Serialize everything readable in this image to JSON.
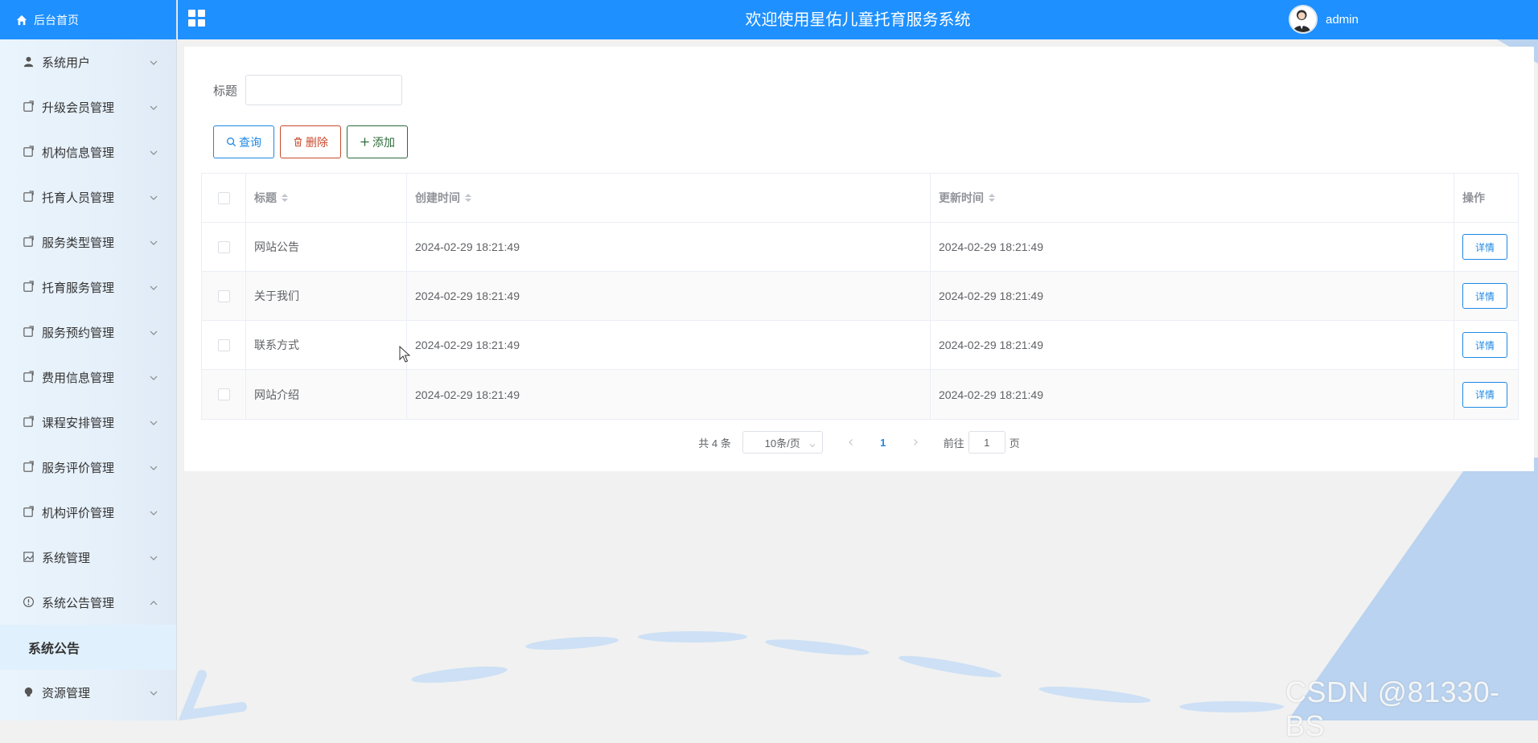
{
  "sidebar": {
    "home_label": "后台首页",
    "items": [
      {
        "label": "系统用户",
        "icon": "user-icon"
      },
      {
        "label": "升级会员管理",
        "icon": "doc-icon"
      },
      {
        "label": "机构信息管理",
        "icon": "doc-icon"
      },
      {
        "label": "托育人员管理",
        "icon": "doc-icon"
      },
      {
        "label": "服务类型管理",
        "icon": "doc-icon"
      },
      {
        "label": "托育服务管理",
        "icon": "doc-icon"
      },
      {
        "label": "服务预约管理",
        "icon": "doc-icon"
      },
      {
        "label": "费用信息管理",
        "icon": "doc-icon"
      },
      {
        "label": "课程安排管理",
        "icon": "doc-icon"
      },
      {
        "label": "服务评价管理",
        "icon": "doc-icon"
      },
      {
        "label": "机构评价管理",
        "icon": "doc-icon"
      },
      {
        "label": "系统管理",
        "icon": "picture-icon"
      },
      {
        "label": "系统公告管理",
        "icon": "info-icon"
      }
    ],
    "active_submenu": "系统公告",
    "last_item": {
      "label": "资源管理",
      "icon": "bulb-icon"
    }
  },
  "header": {
    "title": "欢迎使用星佑儿童托育服务系统",
    "username": "admin"
  },
  "search": {
    "label": "标题",
    "value": "",
    "placeholder": ""
  },
  "buttons": {
    "search": "查询",
    "delete": "删除",
    "add": "添加"
  },
  "table": {
    "columns": [
      "标题",
      "创建时间",
      "更新时间",
      "操作"
    ],
    "rows": [
      {
        "title": "网站公告",
        "created": "2024-02-29 18:21:49",
        "updated": "2024-02-29 18:21:49",
        "action": "详情"
      },
      {
        "title": "关于我们",
        "created": "2024-02-29 18:21:49",
        "updated": "2024-02-29 18:21:49",
        "action": "详情"
      },
      {
        "title": "联系方式",
        "created": "2024-02-29 18:21:49",
        "updated": "2024-02-29 18:21:49",
        "action": "详情"
      },
      {
        "title": "网站介绍",
        "created": "2024-02-29 18:21:49",
        "updated": "2024-02-29 18:21:49",
        "action": "详情"
      }
    ]
  },
  "pagination": {
    "total": "共 4 条",
    "page_size": "10条/页",
    "current_page": "1",
    "goto_prefix": "前往",
    "goto_value": "1",
    "goto_suffix": "页"
  },
  "watermark": "CSDN @81330-BS",
  "colors": {
    "primary": "#1e90ff",
    "danger": "#c9492c",
    "success": "#2d6b3a"
  }
}
